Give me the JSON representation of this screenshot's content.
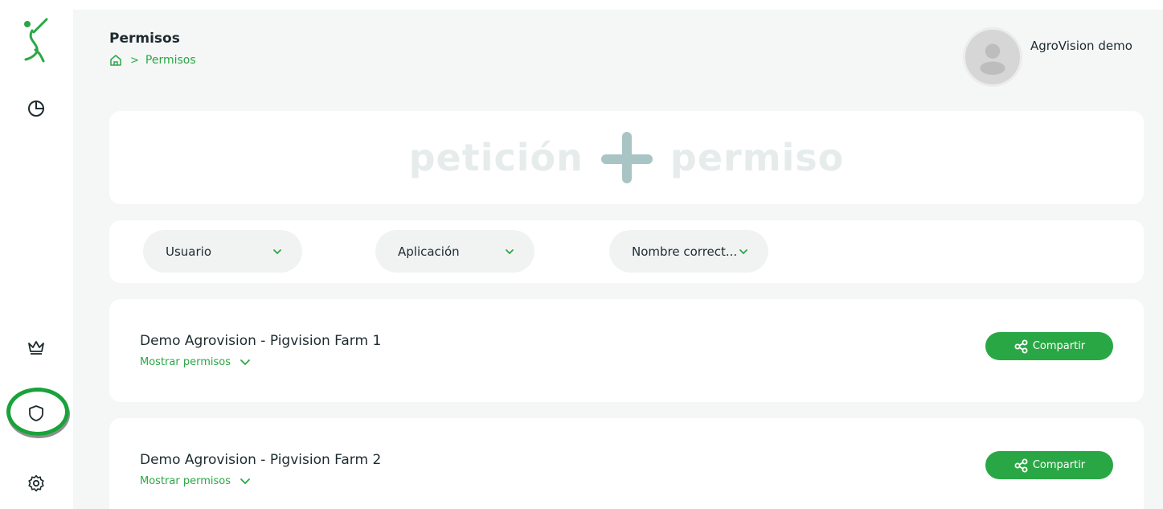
{
  "header": {
    "title": "Permisos",
    "breadcrumb_current": "Permisos",
    "breadcrumb_separator": ">",
    "user_name": "AgroVision demo"
  },
  "hero": {
    "left_word": "petición",
    "right_word": "permiso"
  },
  "filters": [
    {
      "label": "Usuario"
    },
    {
      "label": "Aplicación"
    },
    {
      "label": "Nombre correct..."
    }
  ],
  "farms": [
    {
      "title": "Demo Agrovision - Pigvision Farm 1",
      "toggle_label": "Mostrar permisos",
      "share_label": "Compartir"
    },
    {
      "title": "Demo Agrovision - Pigvision Farm 2",
      "toggle_label": "Mostrar permisos",
      "share_label": "Compartir"
    }
  ],
  "sidebar": {
    "items": [
      {
        "icon": "pie-chart-icon"
      },
      {
        "icon": "crown-icon"
      },
      {
        "icon": "shield-icon",
        "active": true
      },
      {
        "icon": "gear-icon"
      }
    ]
  },
  "colors": {
    "accent": "#2aa745",
    "background": "#f5f6f6",
    "card": "#ffffff"
  }
}
